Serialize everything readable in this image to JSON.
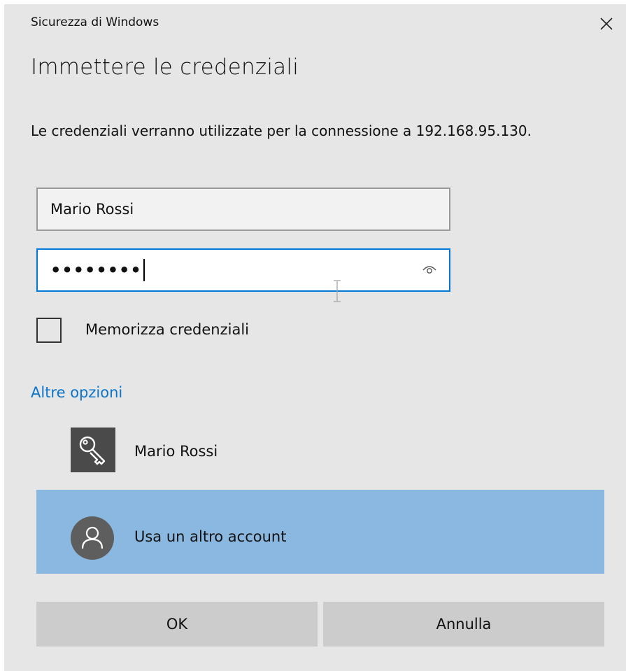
{
  "window": {
    "title": "Sicurezza di Windows",
    "close_icon": "close-icon"
  },
  "heading": "Immettere le credenziali",
  "description": "Le credenziali verranno utilizzate per la connessione a 192.168.95.130.",
  "form": {
    "username_value": "Mario Rossi",
    "password_masked": "••••••••",
    "password_reveal_icon": "eye-icon",
    "remember_label": "Memorizza credenziali",
    "remember_checked": false
  },
  "more_options": {
    "label": "Altre opzioni",
    "accounts": [
      {
        "label": "Mario Rossi",
        "icon": "key-icon",
        "selected": false
      },
      {
        "label": "Usa un altro account",
        "icon": "user-icon",
        "selected": true
      }
    ]
  },
  "buttons": {
    "ok": "OK",
    "cancel": "Annulla"
  },
  "colors": {
    "dialog_bg": "#e6e6e6",
    "accent": "#0078d7",
    "link": "#0a74c9",
    "selected_row": "#8ab8e0",
    "button_bg": "#cccccc"
  }
}
